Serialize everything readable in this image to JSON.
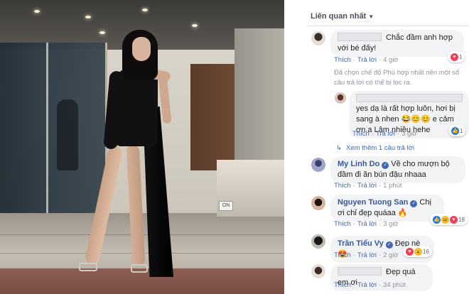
{
  "comments_panel": {
    "sort_label": "Liên quan nhất",
    "items": [
      {
        "text": "Chắc đầm anh hợp với bé đấy!",
        "actions": {
          "like": "Thích",
          "reply": "Trả lời",
          "time": "4 giờ"
        },
        "reaction_count": "1"
      }
    ],
    "hidden_note": "Đã chọn chế độ Phù hợp nhất nên một số câu trả lời có thể bị lọc ra.",
    "reply": {
      "text": "yes dạ là rất hợp luôn, hơi bị sang à nhen 😂😊😊 e cảm ơn a Lâm nhiều hehe",
      "actions": {
        "like": "Thích",
        "reply": "Trả lời",
        "time": "3 giờ"
      },
      "reaction_count": "1"
    },
    "view_more": "Xem thêm 1 câu trả lời",
    "comment_2": {
      "name": "My Linh Do",
      "text": "Về cho mượn bộ đầm đi ăn bún đậu nhaaa",
      "actions": {
        "like": "Thích",
        "reply": "Trả lời",
        "time": "1 phút"
      }
    },
    "comment_3": {
      "name": "Nguyen Tuong San",
      "text": "Chị ơi chỉ đẹp quáaa 🔥",
      "actions": {
        "like": "Thích",
        "reply": "Trả lời",
        "time": "3 giờ"
      },
      "reaction_count": "18"
    },
    "comment_4": {
      "name": "Trần Tiểu Vy",
      "text": "Đẹp nè 😍",
      "actions": {
        "like": "Thích",
        "reply": "Trả lời",
        "time": "2 giờ"
      },
      "reaction_count": "16"
    },
    "comment_5": {
      "text": "Đẹp quá em ơi",
      "actions": {
        "like": "Thích",
        "reply": "Trả lời",
        "time": "34 phút"
      }
    }
  },
  "photo": {
    "wall_switch_label": "ON"
  },
  "colors": {
    "link": "#385898",
    "bubble": "#f2f3f5",
    "meta": "#90949c",
    "heart": "#f33e58",
    "like": "#1877f2"
  },
  "icons": [
    "verified-badge-icon",
    "heart-reaction-icon",
    "like-reaction-icon",
    "haha-reaction-icon",
    "wow-reaction-icon",
    "reply-arrow-icon",
    "caret-down-icon"
  ]
}
